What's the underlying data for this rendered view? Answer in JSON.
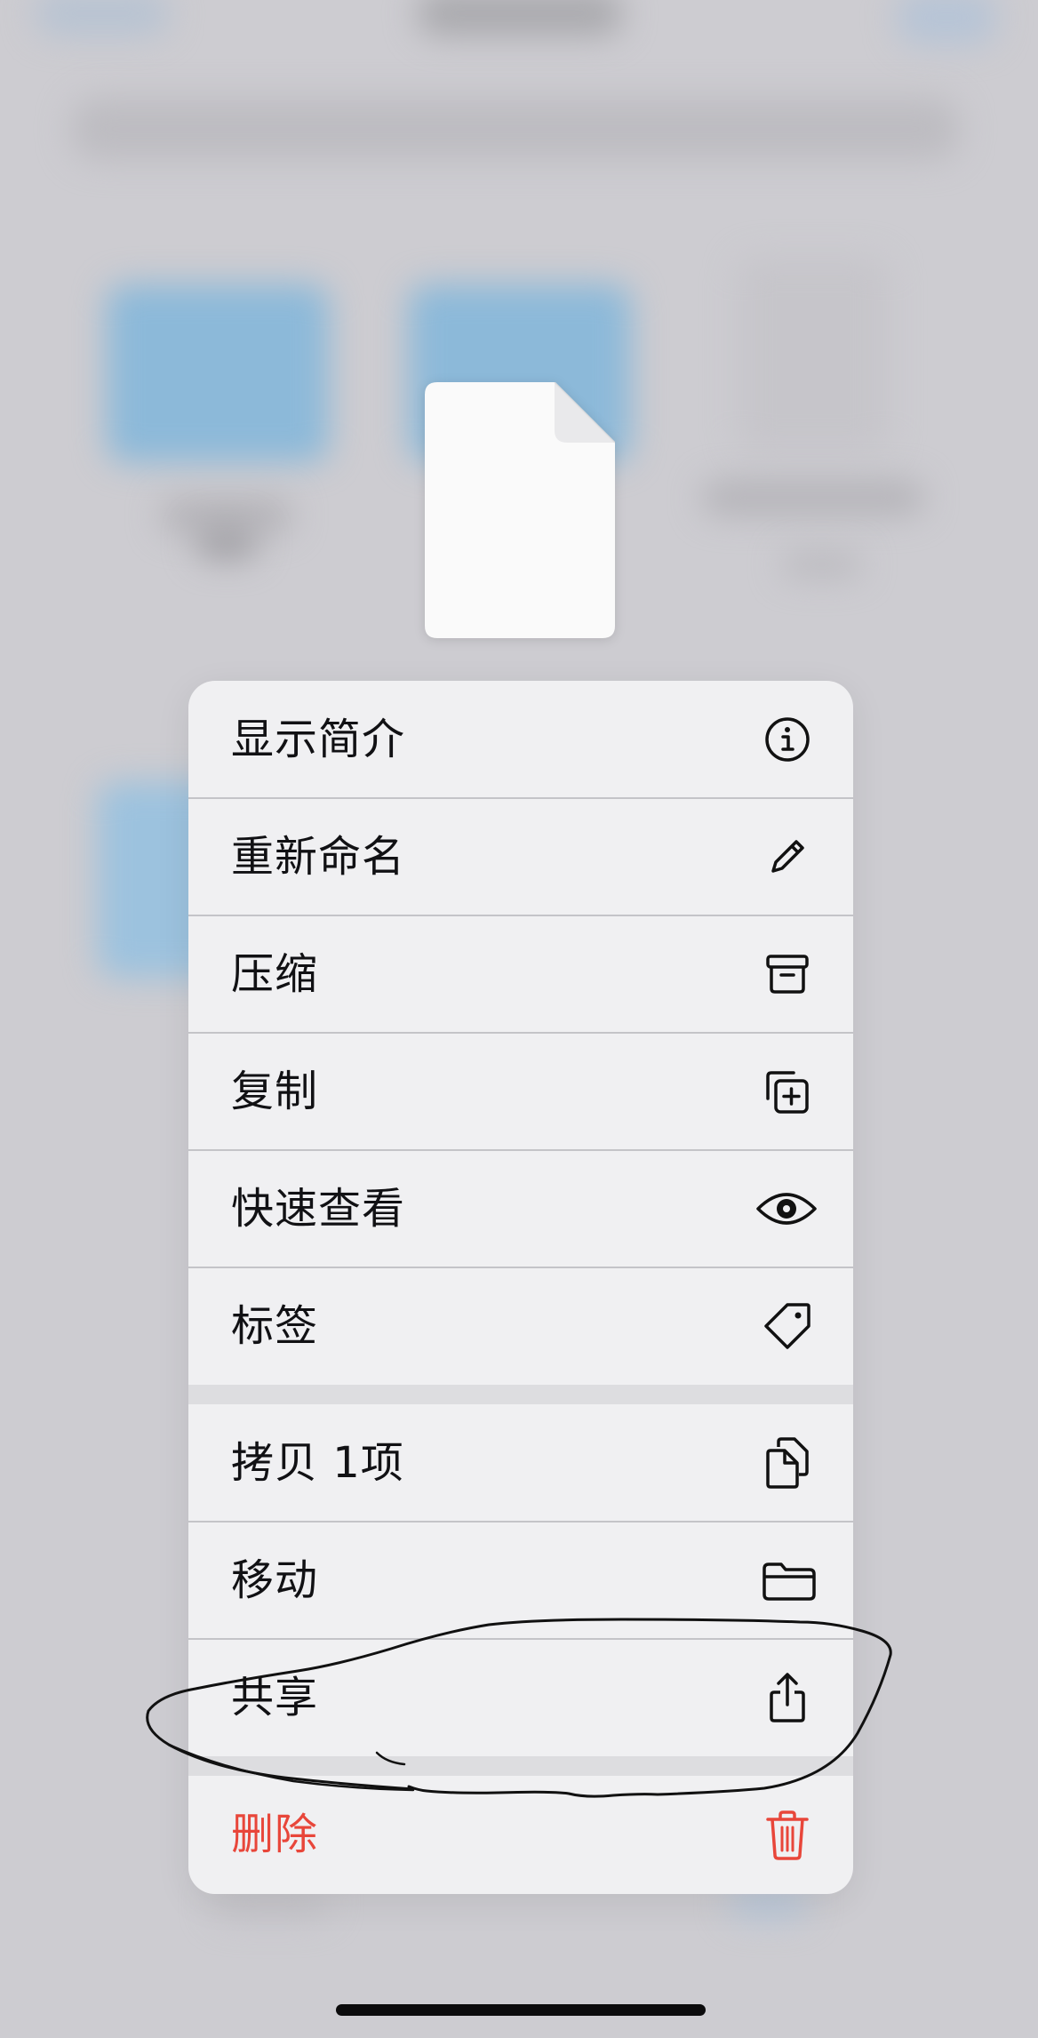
{
  "menu": {
    "group1": [
      {
        "label": "显示简介",
        "icon": "info-circle-icon"
      },
      {
        "label": "重新命名",
        "icon": "pencil-icon"
      },
      {
        "label": "压缩",
        "icon": "archivebox-icon"
      },
      {
        "label": "复制",
        "icon": "plus-square-on-square-icon"
      },
      {
        "label": "快速查看",
        "icon": "eye-icon"
      },
      {
        "label": "标签",
        "icon": "tag-icon"
      }
    ],
    "group2": [
      {
        "label": "拷贝 1项",
        "icon": "doc-on-doc-icon"
      },
      {
        "label": "移动",
        "icon": "folder-icon"
      },
      {
        "label": "共享",
        "icon": "share-icon"
      }
    ],
    "delete": {
      "label": "删除",
      "icon": "trash-icon"
    }
  },
  "colors": {
    "destructive": "#e8463a",
    "menu_background": "#f0f0f2",
    "backdrop": "#cdccd1",
    "folder_blue": "#8cb9d9"
  }
}
